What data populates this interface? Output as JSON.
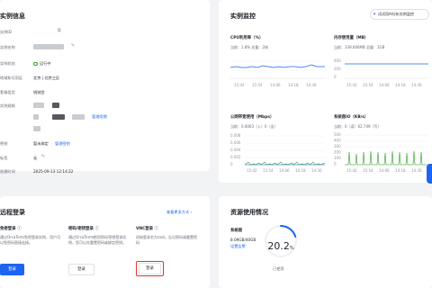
{
  "instance_info": {
    "title": "实例信息",
    "rows": [
      {
        "label": "实例ID",
        "value": ""
      },
      {
        "label": "实例名称",
        "value": ""
      },
      {
        "label": "实例状态",
        "value": "运行中"
      },
      {
        "label": "地域和可用区",
        "value": "北京 | 北京三区"
      },
      {
        "label": "套餐类型",
        "value": "锐驰型"
      },
      {
        "label": "实例规格",
        "value": ""
      },
      {
        "label": "密钥",
        "value": "暂未绑定"
      },
      {
        "label": "标签",
        "value": "无"
      },
      {
        "label": "创建时间",
        "value": "2025-09-13 12:14:22"
      }
    ],
    "manage_renew_link": "管理续期",
    "manage_key_link": "管理密钥",
    "status_color": "#2ea121"
  },
  "monitoring": {
    "title": "实例监控",
    "ai_button": "试试用AI分析实例监控",
    "charts": [
      {
        "title": "CPU利用率（%）",
        "stat": "当前：1.8% 总量：2核",
        "ticks": [
          "15:42",
          "15:54",
          "14:06",
          "14:18",
          "14:30"
        ],
        "y_ticks": [],
        "color": "#1c64f2"
      },
      {
        "title": "内存使用量（MB）",
        "stat": "当前：339.666MB 总量：1GB",
        "ticks": [
          "15:42",
          "15:54",
          "14:06",
          "14:18",
          "14:30"
        ],
        "y_ticks": [
          "400",
          "200",
          "0"
        ],
        "color": "#1c64f2"
      },
      {
        "title": "公网带宽使用（Mbps）",
        "stat": "当前：0.0003（入）0（出）",
        "ticks": [
          "15:42",
          "15:54",
          "14:06",
          "14:18",
          "14:30"
        ],
        "y_ticks": [
          "0.008",
          "0.006",
          "0.004",
          "0.002",
          "0"
        ],
        "color": "#2ea121"
      },
      {
        "title": "系统盘IO（KB/s）",
        "stat": "当前：0（读）62.749（写）",
        "ticks": [
          "15:42",
          "15:54",
          "14:06",
          "14:18",
          "14:30"
        ],
        "y_ticks": [
          "500",
          "400",
          "300",
          "200",
          "100",
          "0"
        ],
        "color": "#2ea121"
      }
    ]
  },
  "remote_login": {
    "title": "远程登录",
    "more_link": "查看更多方式",
    "methods": [
      {
        "title": "免密登录",
        "desc": "通过OrcaTerm免密登录实例，用户可以免密码直接连接。",
        "button": "登录"
      },
      {
        "title": "密码/密钥登录",
        "desc": "通过OrcaTerm使用密码/密钥登录实例，您可以先重置密码或绑定密钥。",
        "button": "登录"
      },
      {
        "title": "VNC登录",
        "desc": "初始登录名为root，忘记密码请重置密码",
        "button": "登录"
      }
    ]
  },
  "resource_usage": {
    "title": "资源使用情况",
    "disk_label": "系统盘",
    "disk_amount": "8.09GB/40GB",
    "disk_link": "设置告警",
    "percent": "20.2",
    "percent_unit": "%",
    "percent_fraction": 0.202,
    "used_label": "已使用"
  }
}
